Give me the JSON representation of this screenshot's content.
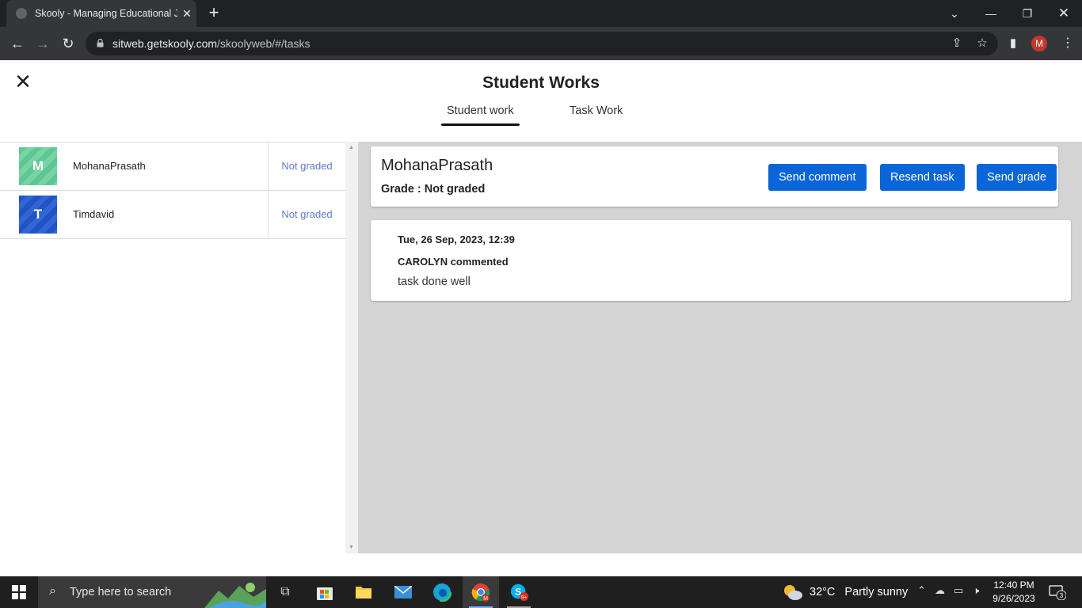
{
  "browser": {
    "tab_title": "Skooly - Managing Educational J",
    "url_host": "sitweb.getskooly.com",
    "url_path": "/skoolyweb/#/tasks",
    "profile_initial": "M"
  },
  "page": {
    "title": "Student Works",
    "tabs": [
      {
        "label": "Student work",
        "active": true
      },
      {
        "label": "Task Work",
        "active": false
      }
    ]
  },
  "students": [
    {
      "initial": "M",
      "name": "MohanaPrasath",
      "grade": "Not graded",
      "color": "#5dc793"
    },
    {
      "initial": "T",
      "name": "Timdavid",
      "grade": "Not graded",
      "color": "#1f54c7"
    }
  ],
  "detail": {
    "name": "MohanaPrasath",
    "grade": "Grade : Not graded",
    "buttons": {
      "comment": "Send comment",
      "resend": "Resend task",
      "grade": "Send grade"
    },
    "comment": {
      "date": "Tue, 26 Sep, 2023, 12:39",
      "author": "CAROLYN commented",
      "text": "task done well"
    }
  },
  "taskbar": {
    "search_placeholder": "Type here to search",
    "weather_temp": "32°C",
    "weather_desc": "Partly sunny",
    "time": "12:40 PM",
    "date": "9/26/2023",
    "notification_count": "3",
    "skype_badge": "9+"
  },
  "colors": {
    "accent": "#0a66d8",
    "link": "#5b7ec9",
    "panel_bg": "#d4d4d4"
  }
}
